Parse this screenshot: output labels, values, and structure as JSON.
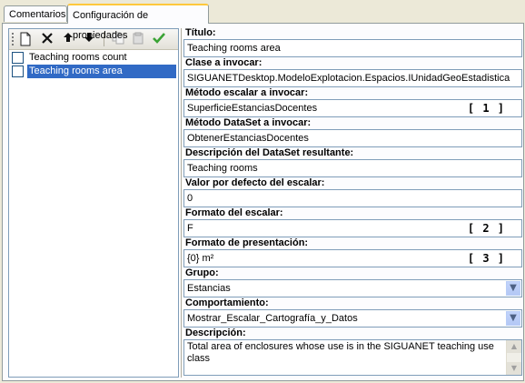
{
  "tabs": [
    {
      "label": "Comentarios"
    },
    {
      "label": "Configuración de propiedades"
    }
  ],
  "toolbar_icons": [
    "new-icon",
    "delete-icon",
    "move-up-icon",
    "move-down-icon",
    "copy-icon",
    "paste-icon",
    "accept-check-icon"
  ],
  "tree": {
    "items": [
      {
        "label": "Teaching rooms count",
        "checked": false,
        "selected": false
      },
      {
        "label": "Teaching rooms area",
        "checked": false,
        "selected": true
      }
    ]
  },
  "fields": {
    "titulo": {
      "label": "Título:",
      "value": "Teaching rooms area"
    },
    "clase": {
      "label": "Clase a invocar:",
      "value": "SIGUANETDesktop.ModeloExplotacion.Espacios.IUnidadGeoEstadistica"
    },
    "metodo_escalar": {
      "label": "Método escalar a invocar:",
      "value": "SuperficieEstanciasDocentes",
      "note": "[ 1 ]"
    },
    "metodo_dataset": {
      "label": "Método DataSet a invocar:",
      "value": "ObtenerEstanciasDocentes"
    },
    "desc_dataset": {
      "label": "Descripción del DataSet resultante:",
      "value": "Teaching rooms"
    },
    "valor_defecto": {
      "label": "Valor por defecto del escalar:",
      "value": "0"
    },
    "formato_escalar": {
      "label": "Formato del escalar:",
      "value": "F",
      "note": "[ 2 ]"
    },
    "formato_presentacion": {
      "label": "Formato de presentación:",
      "value": "{0} m²",
      "note": "[ 3 ]"
    },
    "grupo": {
      "label": "Grupo:",
      "value": "Estancias"
    },
    "comportamiento": {
      "label": "Comportamiento:",
      "value": "Mostrar_Escalar_Cartografía_y_Datos"
    },
    "descripcion": {
      "label": "Descripción:",
      "value": "Total area of enclosures whose use is in the SIGUANET teaching use class"
    }
  },
  "colors": {
    "selection": "#316ac5",
    "active_tab_accent": "#ffc83c",
    "check_icon": "#3aa335"
  }
}
